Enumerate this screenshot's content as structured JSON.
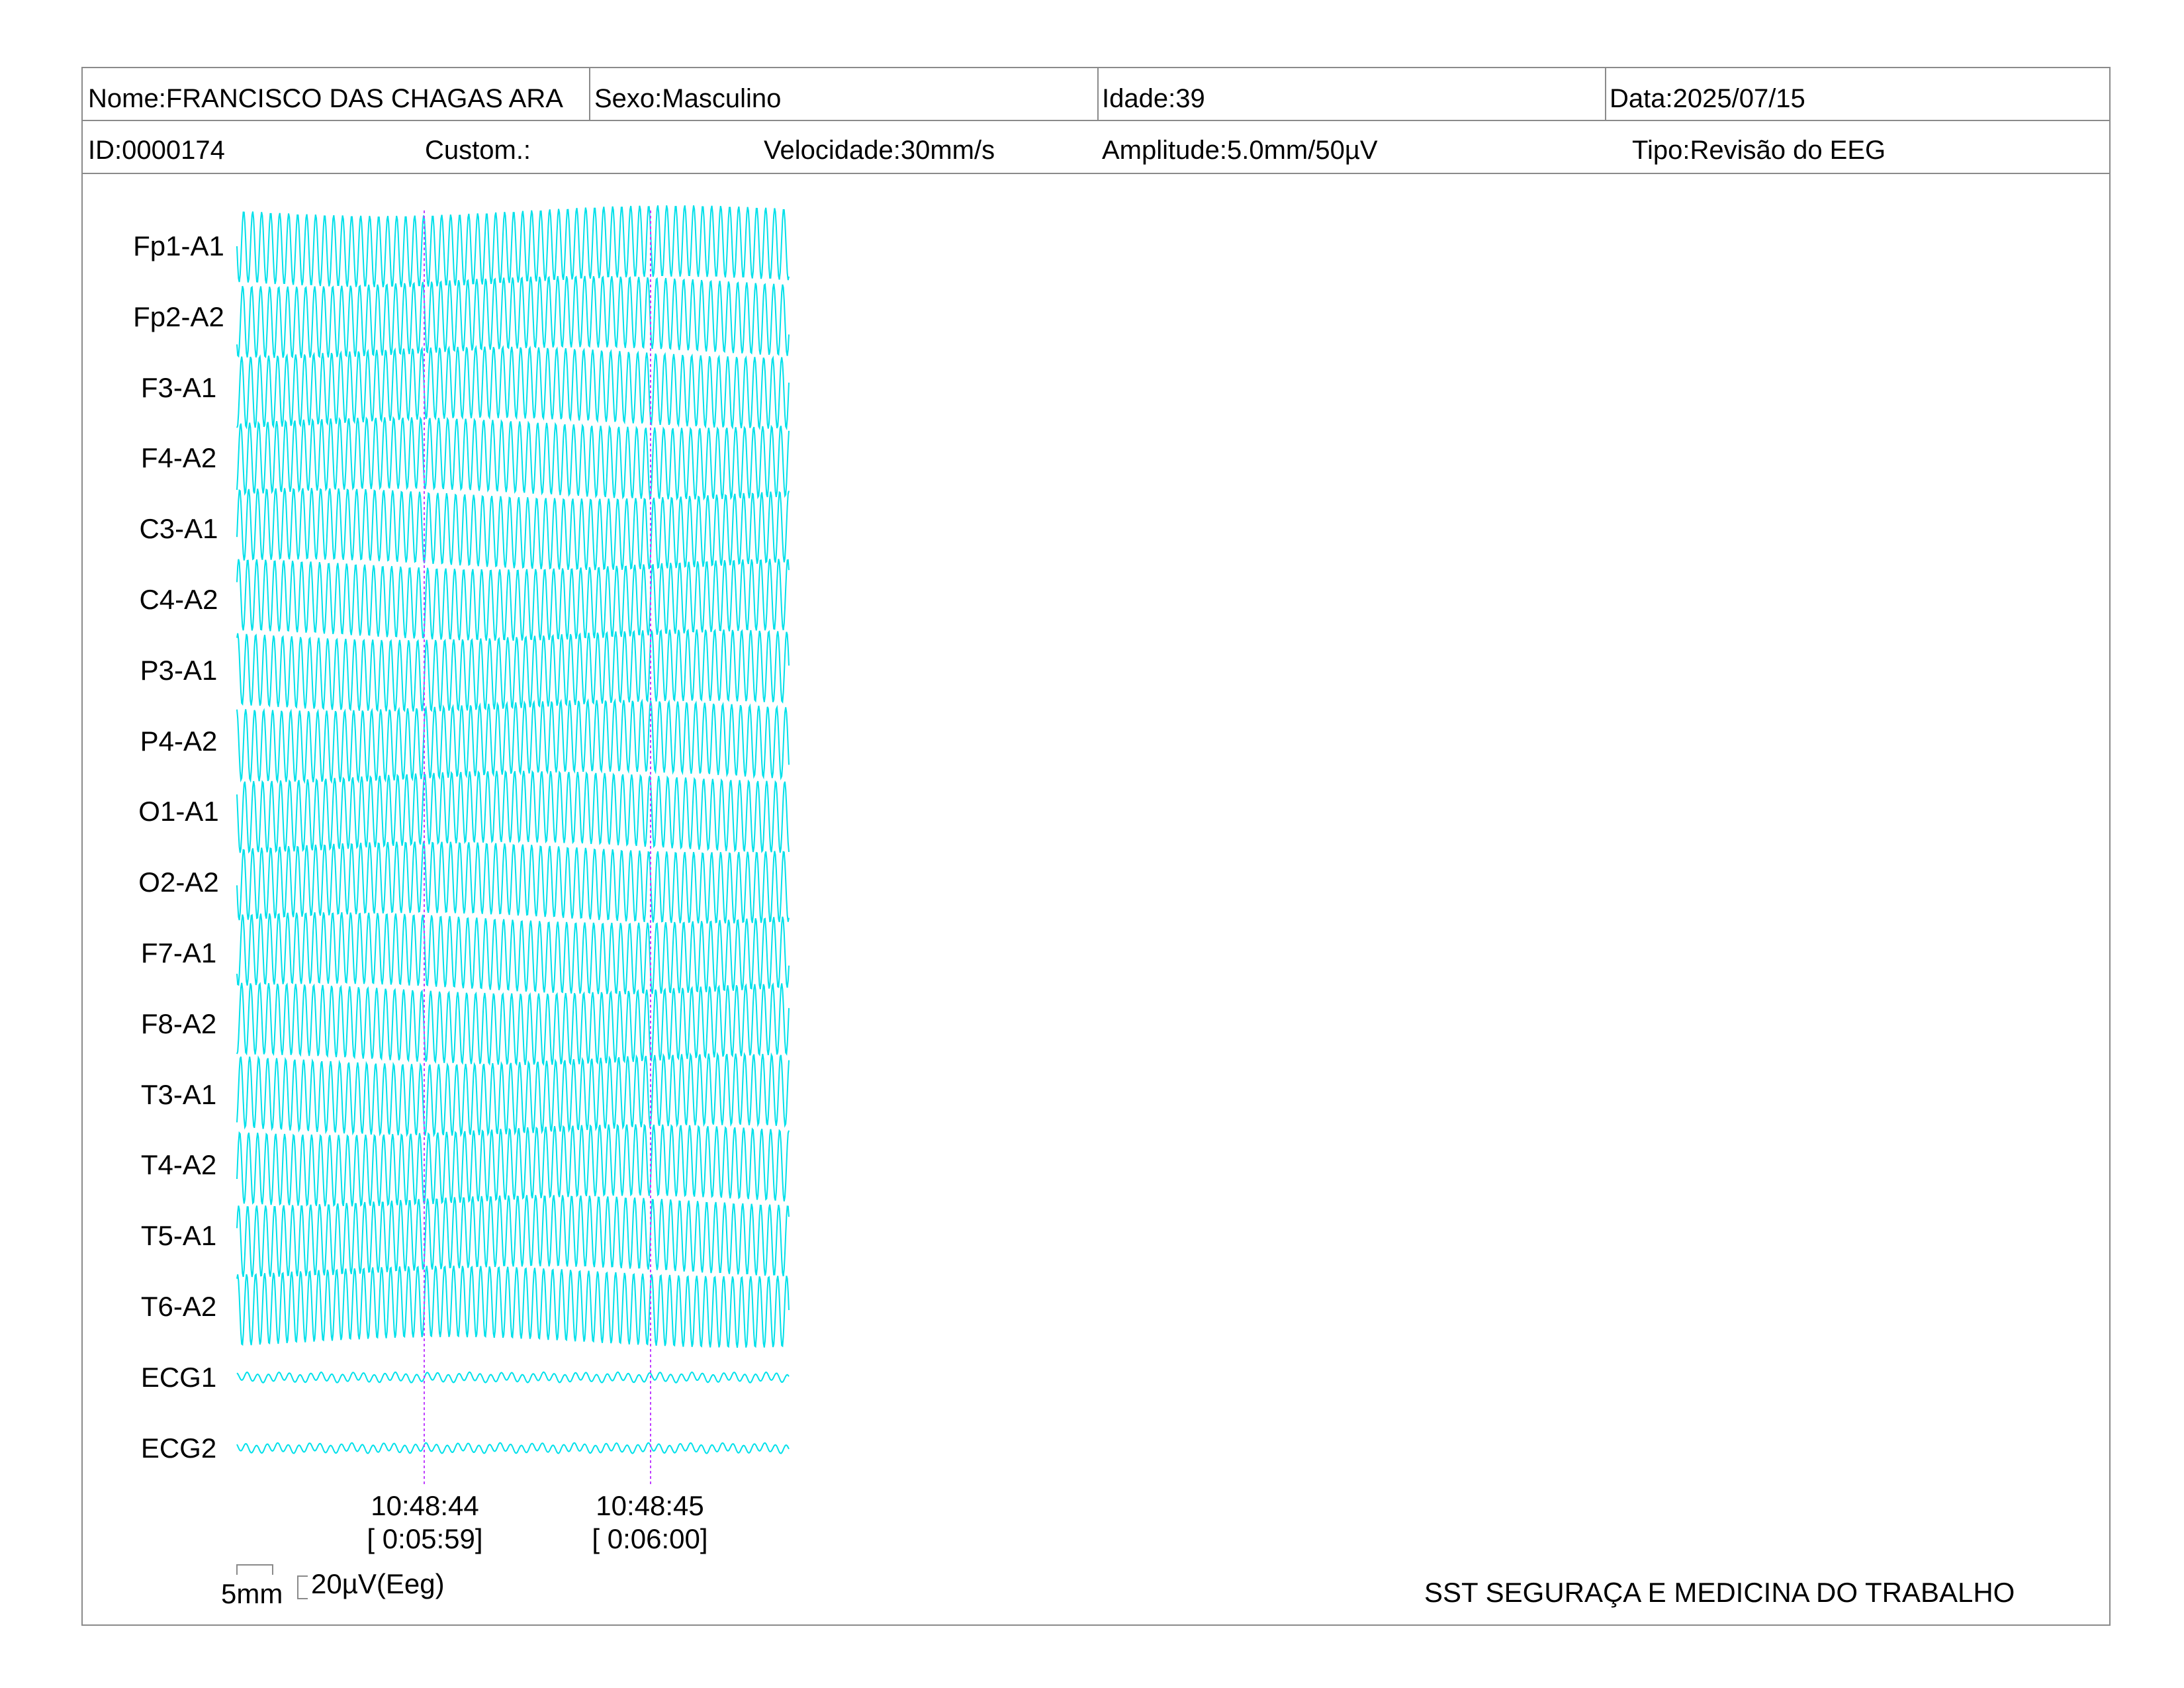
{
  "header": {
    "name": "Nome:FRANCISCO DAS CHAGAS ARA",
    "sex": "Sexo:Masculino",
    "age": "Idade:39",
    "date": "Data:2025/07/15",
    "id": "ID:0000174",
    "custom": "Custom.:",
    "speed": "Velocidade:30mm/s",
    "amplitude": "Amplitude:5.0mm/50µV",
    "type": "Tipo:Revisão do EEG"
  },
  "channels": [
    "Fp1-A1",
    "Fp2-A2",
    "F3-A1",
    "F4-A2",
    "C3-A1",
    "C4-A2",
    "P3-A1",
    "P4-A2",
    "O1-A1",
    "O2-A2",
    "F7-A1",
    "F8-A2",
    "T3-A1",
    "T4-A2",
    "T5-A1",
    "T6-A2",
    "ECG1",
    "ECG2"
  ],
  "time_markers": [
    {
      "clock": "10:48:44",
      "elapsed": "[ 0:05:59]"
    },
    {
      "clock": "10:48:45",
      "elapsed": "[ 0:06:00]"
    }
  ],
  "scale": {
    "time": "5mm",
    "amplitude": "20µV(Eeg)"
  },
  "footer": {
    "organization": "SST SEGURAÇA E MEDICINA DO TRABALHO"
  },
  "colors": {
    "trace": "#00e0ea",
    "marker": "#c040ff",
    "border": "#8a8a8a"
  }
}
